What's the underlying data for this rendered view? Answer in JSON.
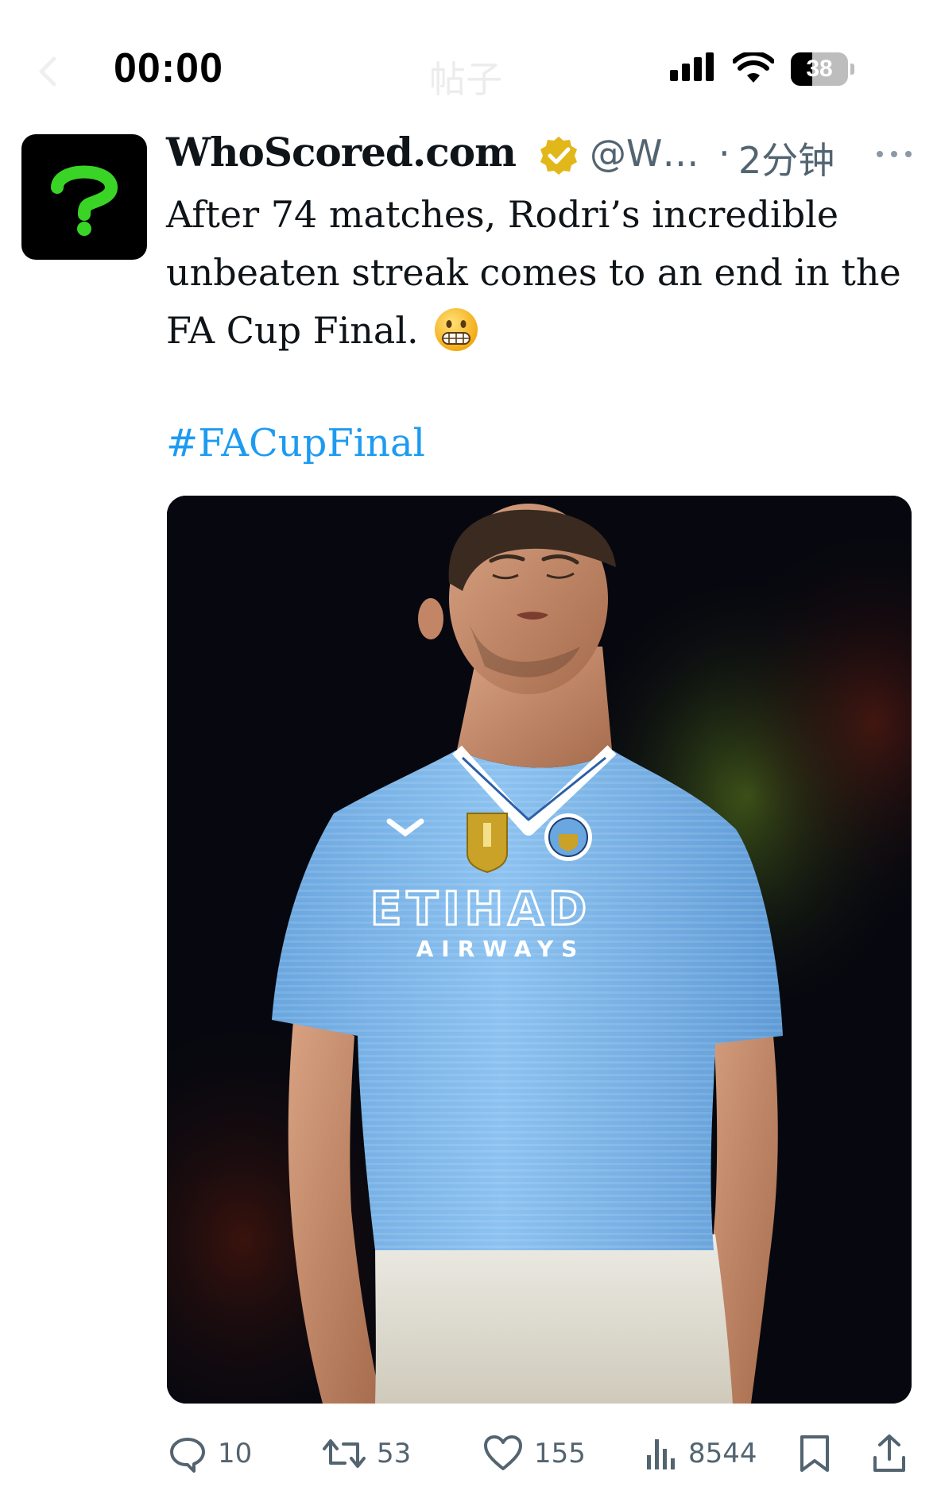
{
  "status_bar": {
    "time": "00:00",
    "battery_level": "38",
    "battery_fraction": 0.38,
    "background_title": "帖子"
  },
  "tweet": {
    "author": {
      "name": "WhoScored.com",
      "handle": "@W…",
      "verified": true,
      "avatar_color": "#000000",
      "avatar_glyph_color": "#3ad427"
    },
    "separator": "·",
    "time": "2分钟",
    "text_lines": [
      "After 74 matches, Rodri’s incredible",
      "unbeaten streak comes to an end in the",
      "FA Cup Final."
    ],
    "emoji": "grimacing-face",
    "hashtag": "#FACupFinal",
    "image": {
      "jersey_sponsor": "ETIHAD",
      "jersey_sponsor_sub": "AIRWAYS"
    },
    "stats": {
      "replies": "10",
      "retweets": "53",
      "likes": "155",
      "views": "8544"
    }
  },
  "colors": {
    "text_primary": "#0f1419",
    "text_secondary": "#536471",
    "link": "#1d9bf0",
    "verified_gold": "#e2b719"
  }
}
